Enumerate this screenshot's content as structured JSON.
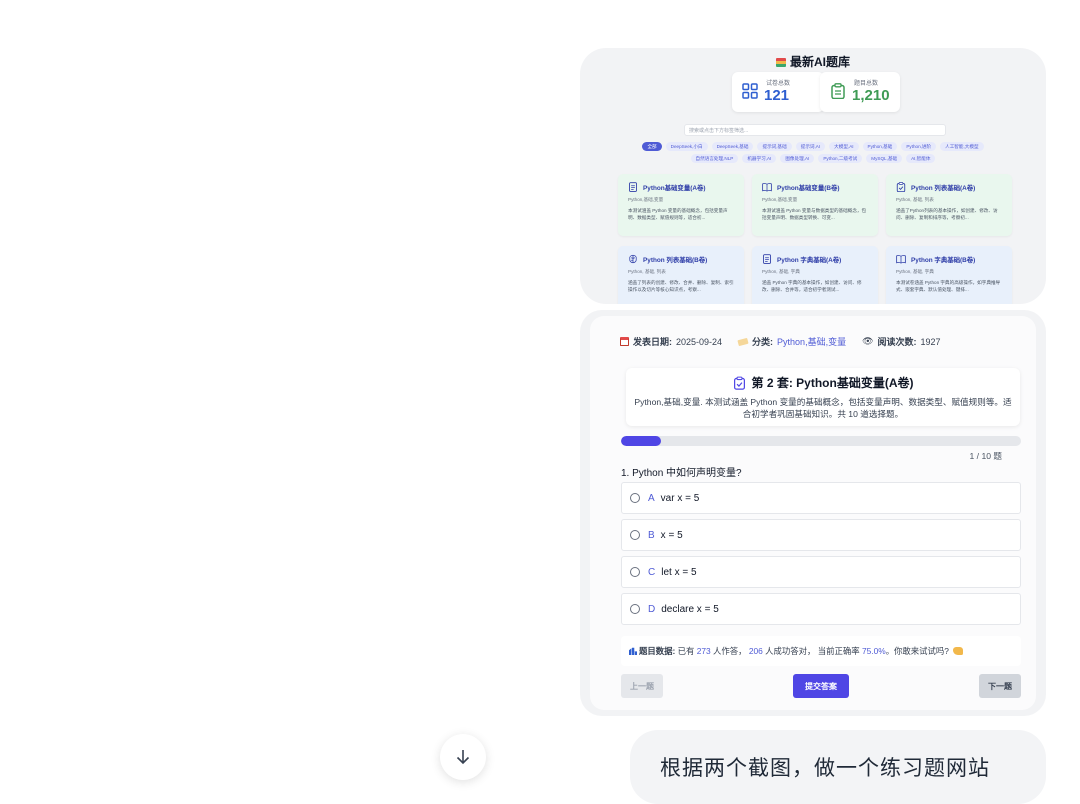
{
  "site": {
    "title": "最新AI题库",
    "stats": {
      "papers_label": "试卷总数",
      "papers_value": "121",
      "questions_label": "题目总数",
      "questions_value": "1,210"
    },
    "search_placeholder": "搜索或点击下方标签筛选...",
    "tags": [
      "全部",
      "DeepSeek,小白",
      "DeepSeek,基础",
      "提示词,基础",
      "提示词,AI",
      "大模型,AI",
      "Python,基础",
      "Python,进阶",
      "人工智能,大模型",
      "自然语言处理,NLP",
      "机器学习,AI",
      "图像处理,AI",
      "Python,二级考试",
      "MySQL,基础",
      "AI,智能体"
    ],
    "cards": [
      {
        "title": "Python基础变量(A卷)",
        "sub": "Python,基础,变量",
        "desc": "本测试涵盖 Python 变量的基础概念，包括变量声明、数据类型、赋值规则等，适合初...",
        "icon": "document-icon"
      },
      {
        "title": "Python基础变量(B卷)",
        "sub": "Python,基础,变量",
        "desc": "本测试涵盖 Python 变量与数据类型的基础概念，包括变量声明、数据类型转换、可变...",
        "icon": "book-icon"
      },
      {
        "title": "Python 列表基础(A卷)",
        "sub": "Python, 基础, 列表",
        "desc": "涵盖了Python列表的基本操作，如创建、修改、访问、删除、复制和排序等，考察初...",
        "icon": "clipboard-icon"
      },
      {
        "title": "Python 列表基础(B卷)",
        "sub": "Python, 基础, 列表",
        "desc": "涵盖了列表的创建、修改、合并、删除、复制、索引操作以及切片等核心知识点，考察...",
        "icon": "brain-icon"
      },
      {
        "title": "Python 字典基础(A卷)",
        "sub": "Python, 基础, 字典",
        "desc": "涵盖 Python 字典的基本操作，如创建、访问、修改、删除、合并等，适合初学者测试...",
        "icon": "document-icon"
      },
      {
        "title": "Python 字典基础(B卷)",
        "sub": "Python, 基础, 字典",
        "desc": "本测试卷涵盖 Python 字典的高级操作，如字典推导式、嵌套字典、默认值处理、键排...",
        "icon": "book-icon"
      }
    ]
  },
  "quiz": {
    "date_label": "发表日期:",
    "date_value": "2025-09-24",
    "category_label": "分类:",
    "category_value": "Python,基础,变量",
    "reads_label": "阅读次数:",
    "reads_value": "1927",
    "title": "第 2 套: Python基础变量(A卷)",
    "description": "Python,基础,变量. 本测试涵盖 Python 变量的基础概念，包括变量声明、数据类型、赋值规则等。适合初学者巩固基础知识。共 10 道选择题。",
    "progress_fraction": 0.1,
    "progress_text": "1 / 10 题",
    "question": "1. Python 中如何声明变量?",
    "options": [
      {
        "letter": "A",
        "text": "var x = 5"
      },
      {
        "letter": "B",
        "text": "x = 5"
      },
      {
        "letter": "C",
        "text": "let x = 5"
      },
      {
        "letter": "D",
        "text": "declare x = 5"
      }
    ],
    "stats": {
      "label": "题目数据:",
      "p1": "已有",
      "attempts": "273",
      "p2": "人作答，",
      "correct": "206",
      "p3": "人成功答对，  当前正确率",
      "rate": "75.0%",
      "p4": "。你敢来试试吗?"
    },
    "buttons": {
      "prev": "上一题",
      "submit": "提交答案",
      "next": "下一题"
    }
  },
  "chat": {
    "message": "根据两个截图，做一个练习题网站"
  },
  "colors": {
    "accent": "#4f46e5",
    "link": "#4f5bd5",
    "green": "#3f9b55",
    "blue": "#2f5fd0"
  }
}
